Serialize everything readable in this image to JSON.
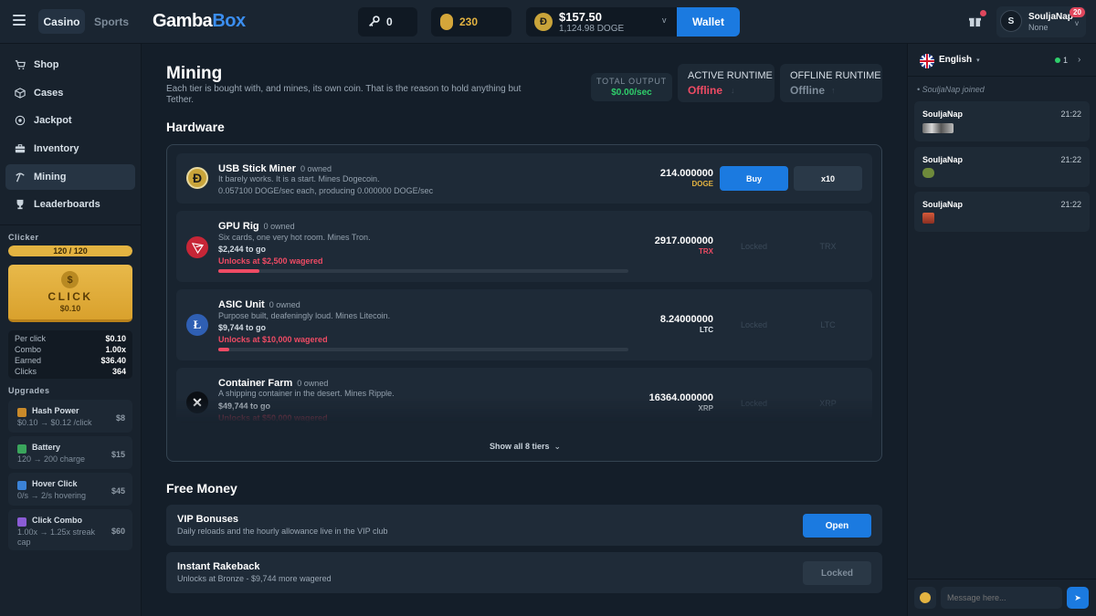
{
  "header": {
    "tabs": [
      "Casino",
      "Sports"
    ],
    "logo_a": "Gamba",
    "logo_b": "Box",
    "keys": "0",
    "gold": "230",
    "balance_usd": "$157.50",
    "balance_doge": "1,124.98 DOGE",
    "wallet_label": "Wallet",
    "notification_dot": true,
    "username": "SouljaNap",
    "user_sub": "None",
    "avatar_letter": "S",
    "level_badge": "20"
  },
  "sidebar": {
    "nav": [
      {
        "label": "Shop",
        "icon": "cart-icon"
      },
      {
        "label": "Cases",
        "icon": "box-icon"
      },
      {
        "label": "Jackpot",
        "icon": "target-icon"
      },
      {
        "label": "Inventory",
        "icon": "briefcase-icon"
      },
      {
        "label": "Mining",
        "icon": "pickaxe-icon",
        "active": true
      },
      {
        "label": "Leaderboards",
        "icon": "trophy-icon"
      }
    ],
    "clicker_title": "Clicker",
    "charge_text": "120 / 120",
    "charge_fraction": 1.0,
    "click_label": "CLICK",
    "click_value": "$0.10",
    "stats": [
      {
        "label": "Per click",
        "value": "$0.10"
      },
      {
        "label": "Combo",
        "value": "1.00x"
      },
      {
        "label": "Earned",
        "value": "$36.40"
      },
      {
        "label": "Clicks",
        "value": "364"
      }
    ],
    "upgrades_title": "Upgrades",
    "upgrades": [
      {
        "name": "Hash Power",
        "detail": "$0.10 → $0.12 /click",
        "price": "$8",
        "color": "#c98a2a"
      },
      {
        "name": "Battery",
        "detail": "120 → 200 charge",
        "price": "$15",
        "color": "#3aa55c"
      },
      {
        "name": "Hover Click",
        "detail": "0/s → 2/s hovering",
        "price": "$45",
        "color": "#3b82d6"
      },
      {
        "name": "Click Combo",
        "detail": "1.00x → 1.25x streak cap",
        "price": "$60",
        "color": "#8b5cd6"
      }
    ]
  },
  "main": {
    "title": "Mining",
    "subtitle": "Each tier is bought with, and mines, its own coin. That is the reason to hold anything but Tether.",
    "total_output_label": "TOTAL OUTPUT",
    "total_output_value": "$0.00/sec",
    "active_runtime_label": "ACTIVE RUNTIME",
    "active_runtime_value": "Offline",
    "offline_runtime_label": "OFFLINE RUNTIME",
    "offline_runtime_value": "Offline",
    "hardware_title": "Hardware",
    "tiers": [
      {
        "name": "USB Stick Miner",
        "owned": "0 owned",
        "desc": "It barely works. It is a start. Mines Dogecoin.",
        "rate": "0.057100 DOGE/sec each, producing 0.000000 DOGE/sec",
        "amount": "214.000000",
        "unit": "DOGE",
        "buy": "Buy",
        "multi": "x10"
      },
      {
        "name": "GPU Rig",
        "owned": "0 owned",
        "desc": "Six cards, one very hot room. Mines Tron.",
        "togo": "$2,244 to go",
        "unlock": "Unlocks at $2,500 wagered",
        "progress": 0.1,
        "amount": "2917.000000",
        "unit": "TRX",
        "locked": "Locked",
        "code": "TRX"
      },
      {
        "name": "ASIC Unit",
        "owned": "0 owned",
        "desc": "Purpose built, deafeningly loud. Mines Litecoin.",
        "togo": "$9,744 to go",
        "unlock": "Unlocks at $10,000 wagered",
        "progress": 0.026,
        "amount": "8.24000000",
        "unit": "LTC",
        "locked": "Locked",
        "code": "LTC"
      },
      {
        "name": "Container Farm",
        "owned": "0 owned",
        "desc": "A shipping container in the desert. Mines Ripple.",
        "togo": "$49,744 to go",
        "unlock": "Unlocks at $50,000 wagered",
        "amount": "16364.000000",
        "unit": "XRP",
        "locked": "Locked",
        "code": "XRP"
      }
    ],
    "show_all": "Show all 8 tiers",
    "free_money_title": "Free Money",
    "vip_title": "VIP Bonuses",
    "vip_desc": "Daily reloads and the hourly allowance live in the VIP club",
    "vip_button": "Open",
    "rakeback_title": "Instant Rakeback",
    "rakeback_desc": "Unlocks at Bronze - $9,744 more wagered",
    "rakeback_button": "Locked"
  },
  "chat": {
    "language": "English",
    "online_count": "1",
    "system_msg": "SouljaNap joined",
    "messages": [
      {
        "user": "SouljaNap",
        "time": "21:22"
      },
      {
        "user": "SouljaNap",
        "time": "21:22"
      },
      {
        "user": "SouljaNap",
        "time": "21:22"
      }
    ],
    "placeholder": "Message here..."
  }
}
